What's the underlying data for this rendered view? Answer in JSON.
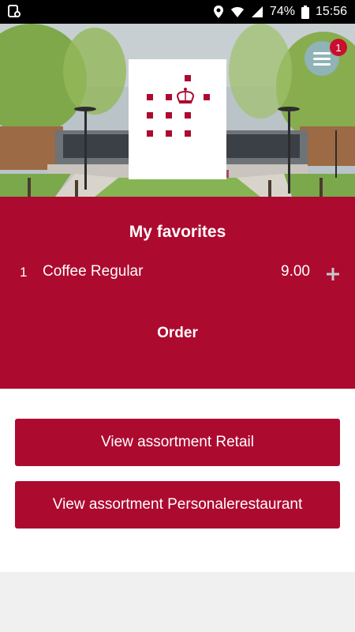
{
  "status_bar": {
    "battery": "74%",
    "time": "15:56",
    "icons": [
      "notification-icon",
      "location-icon",
      "wifi-icon",
      "signal-icon",
      "battery-icon"
    ]
  },
  "menu": {
    "badge_count": "1",
    "icon": "hamburger-menu-icon"
  },
  "favorites": {
    "title": "My favorites",
    "items": [
      {
        "qty": "1",
        "name": "Coffee Regular",
        "price": "9.00",
        "action_icon": "plus-icon"
      }
    ],
    "order_label": "Order"
  },
  "actions": {
    "retail_label": "View assortment Retail",
    "personal_label": "View assortment Personalerestaurant"
  },
  "colors": {
    "brand_red": "#ad0a2f",
    "menu_button": "#8fb3b6",
    "badge": "#c8102e",
    "page_bg": "#f0f0f0"
  }
}
